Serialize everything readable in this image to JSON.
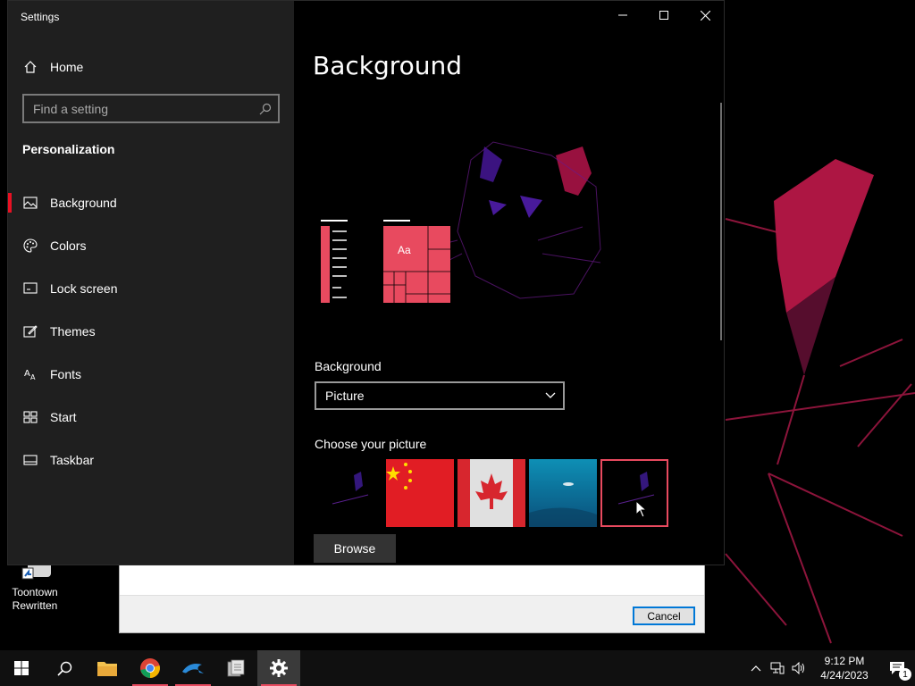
{
  "window": {
    "title": "Settings"
  },
  "nav": {
    "home": "Home",
    "search_placeholder": "Find a setting",
    "section": "Personalization",
    "items": [
      {
        "label": "Background",
        "icon": "picture-icon",
        "active": true
      },
      {
        "label": "Colors",
        "icon": "palette-icon",
        "active": false
      },
      {
        "label": "Lock screen",
        "icon": "lock-screen-icon",
        "active": false
      },
      {
        "label": "Themes",
        "icon": "themes-icon",
        "active": false
      },
      {
        "label": "Fonts",
        "icon": "fonts-icon",
        "active": false
      },
      {
        "label": "Start",
        "icon": "start-icon",
        "active": false
      },
      {
        "label": "Taskbar",
        "icon": "taskbar-icon",
        "active": false
      }
    ]
  },
  "content": {
    "title": "Background",
    "preview_sample": "Aa",
    "background_label": "Background",
    "background_value": "Picture",
    "choose_label": "Choose your picture",
    "browse_label": "Browse"
  },
  "dialog": {
    "cancel_label": "Cancel"
  },
  "desktop": {
    "icon_label": "Toontown Rewritten"
  },
  "taskbar": {
    "time": "9:12 PM",
    "date": "4/24/2023",
    "notification_count": "1"
  },
  "colors": {
    "accent": "#e84a5f",
    "nav_bg": "#1f1f1f",
    "active_indicator": "#e81123"
  }
}
